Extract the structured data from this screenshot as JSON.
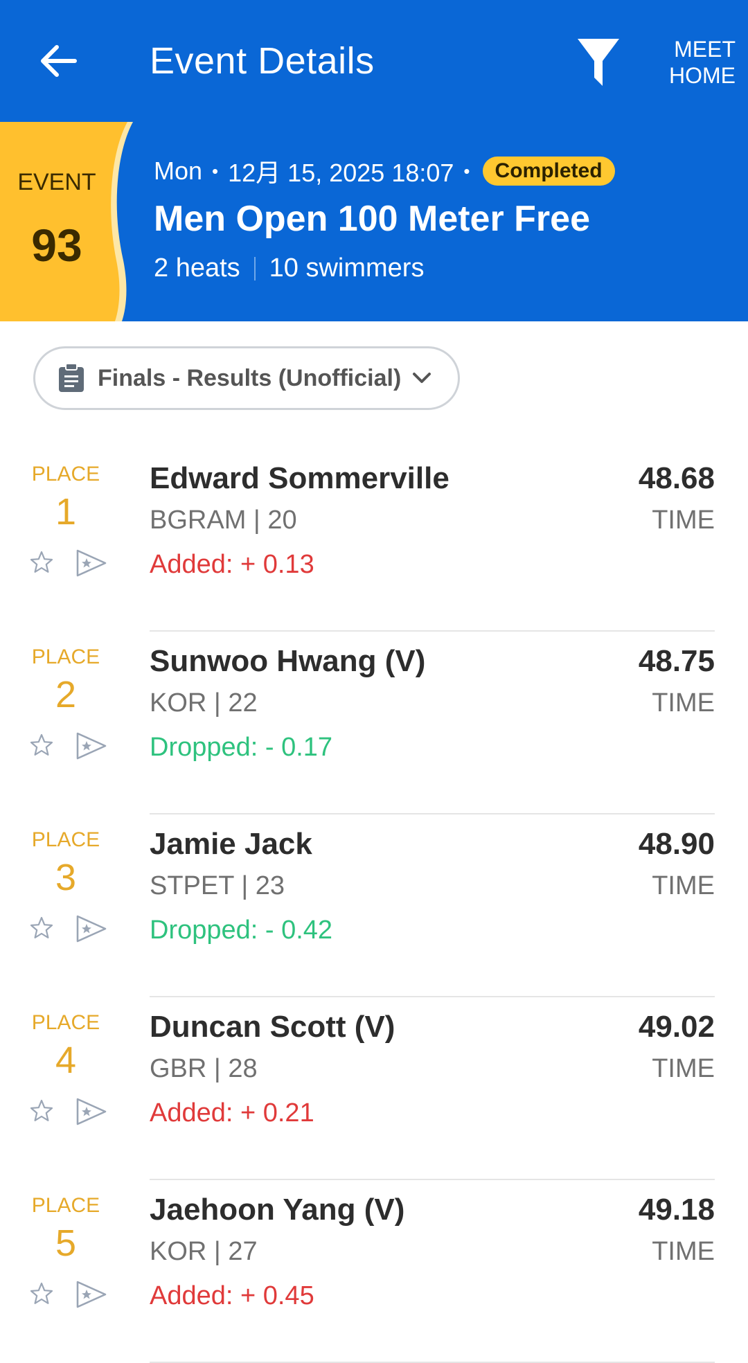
{
  "header": {
    "title": "Event Details",
    "meet_home_line1": "MEET",
    "meet_home_line2": "HOME",
    "back_icon": "arrow-left-icon",
    "filter_icon": "funnel-icon"
  },
  "event": {
    "label": "EVENT",
    "number": "93",
    "day": "Mon",
    "datetime": "12月 15, 2025 18:07",
    "status": "Completed",
    "name": "Men Open 100 Meter Free",
    "heats": "2 heats",
    "swimmers": "10 swimmers"
  },
  "selector": {
    "label": "Finals - Results (Unofficial)",
    "icon": "clipboard-icon"
  },
  "results": [
    {
      "place_label": "PLACE",
      "place": "1",
      "name": "Edward Sommerville",
      "team_age": "BGRAM | 20",
      "diff": "Added: + 0.13",
      "diff_type": "added",
      "time": "48.68",
      "time_label": "TIME"
    },
    {
      "place_label": "PLACE",
      "place": "2",
      "name": "Sunwoo Hwang (V)",
      "team_age": "KOR | 22",
      "diff": "Dropped: - 0.17",
      "diff_type": "dropped",
      "time": "48.75",
      "time_label": "TIME"
    },
    {
      "place_label": "PLACE",
      "place": "3",
      "name": "Jamie Jack",
      "team_age": "STPET | 23",
      "diff": "Dropped: - 0.42",
      "diff_type": "dropped",
      "time": "48.90",
      "time_label": "TIME"
    },
    {
      "place_label": "PLACE",
      "place": "4",
      "name": "Duncan Scott (V)",
      "team_age": "GBR | 28",
      "diff": "Added: + 0.21",
      "diff_type": "added",
      "time": "49.02",
      "time_label": "TIME"
    },
    {
      "place_label": "PLACE",
      "place": "5",
      "name": "Jaehoon Yang (V)",
      "team_age": "KOR | 27",
      "diff": "Added: + 0.45",
      "diff_type": "added",
      "time": "49.18",
      "time_label": "TIME"
    }
  ],
  "colors": {
    "primary": "#0a67d6",
    "accent": "#ffc830",
    "place": "#e6a92a",
    "added": "#e03a3a",
    "dropped": "#2ec27e"
  }
}
